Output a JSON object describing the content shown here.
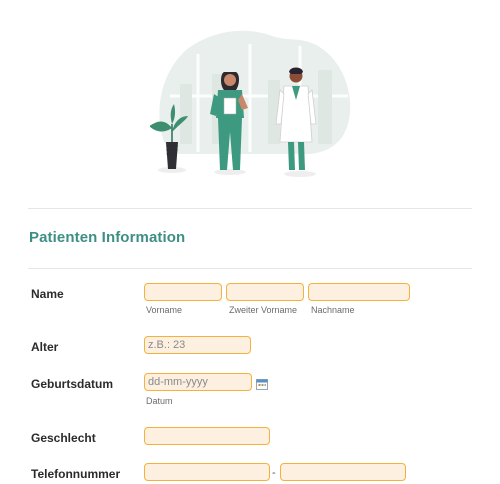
{
  "section": {
    "title": "Patienten Information"
  },
  "fields": {
    "name": {
      "label": "Name",
      "first_hint": "Vorname",
      "middle_hint": "Zweiter Vorname",
      "last_hint": "Nachname",
      "first_value": "",
      "middle_value": "",
      "last_value": ""
    },
    "age": {
      "label": "Alter",
      "placeholder": "z.B.: 23"
    },
    "birthdate": {
      "label": "Geburtsdatum",
      "placeholder": "dd-mm-yyyy",
      "hint": "Datum"
    },
    "gender": {
      "label": "Geschlecht",
      "value": ""
    },
    "phone": {
      "label": "Telefonnummer",
      "separator": "-",
      "area_value": "",
      "number_value": ""
    }
  },
  "icons": {
    "calendar": "calendar-icon",
    "illustration": "doctors-illustration"
  },
  "colors": {
    "accent": "#3d8f86",
    "field_border": "#f4b23c",
    "field_bg": "#fdf0e0"
  }
}
